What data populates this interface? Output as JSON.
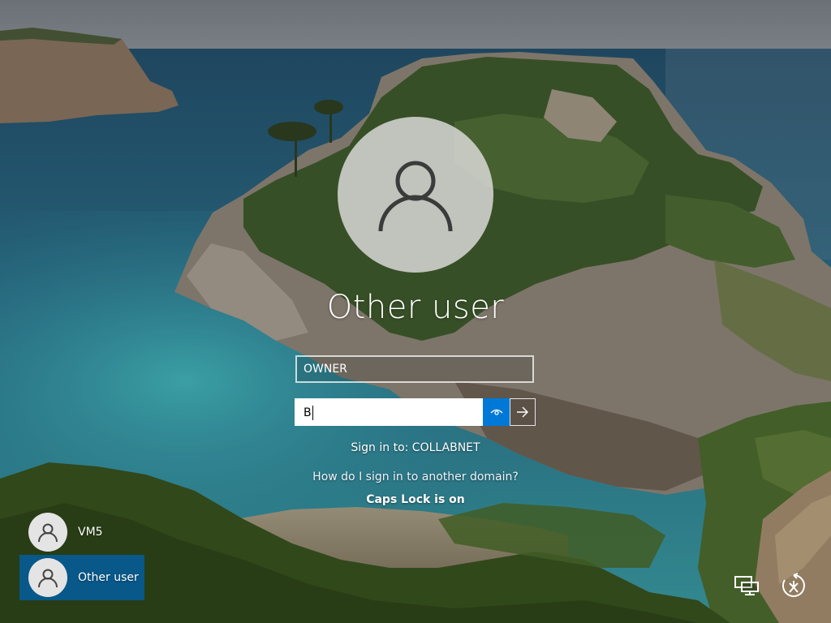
{
  "login": {
    "display_name": "Other user",
    "username_value": "OWNER",
    "password_value": "B",
    "sign_in_to": "Sign in to: COLLABNET",
    "domain_help_link": "How do I sign in to another domain?",
    "caps_lock_warning": "Caps Lock is on"
  },
  "users": [
    {
      "name": "VM5",
      "selected": false
    },
    {
      "name": "Other user",
      "selected": true
    }
  ],
  "icons": {
    "avatar": "user-icon",
    "reveal": "eye-icon",
    "submit": "arrow-right-icon",
    "network": "network-icon",
    "accessibility": "ease-of-access-icon"
  },
  "colors": {
    "accent": "#0078d7",
    "selected_user_bg": "#0060aa"
  }
}
